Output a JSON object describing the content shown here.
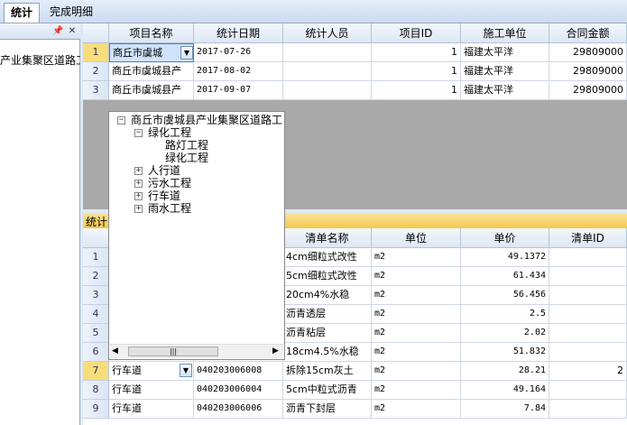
{
  "tabs": [
    {
      "label": "统计"
    },
    {
      "label": "完成明细"
    }
  ],
  "left_panel": {
    "pin_icon": "pin-icon",
    "close_icon": "close-icon",
    "text": "产业集聚区道路工"
  },
  "grid_top": {
    "headers": [
      "项目名称",
      "统计日期",
      "统计人员",
      "项目ID",
      "施工单位",
      "合同金额"
    ],
    "rows": [
      {
        "num": "1",
        "name": "商丘市虞城",
        "date": "2017-07-26",
        "staff": "",
        "id": "1",
        "unit": "福建太平洋",
        "amount": "29809000"
      },
      {
        "num": "2",
        "name": "商丘市虞城县产",
        "date": "2017-08-02",
        "staff": "",
        "id": "1",
        "unit": "福建太平洋",
        "amount": "29809000"
      },
      {
        "num": "3",
        "name": "商丘市虞城县产",
        "date": "2017-09-07",
        "staff": "",
        "id": "1",
        "unit": "福建太平洋",
        "amount": "29809000"
      }
    ]
  },
  "tree": {
    "root": "商丘市虞城县产业集聚区道路工",
    "children": [
      {
        "label": "绿化工程",
        "expanded": true,
        "items": [
          "路灯工程",
          "绿化工程"
        ]
      },
      {
        "label": "人行道",
        "expanded": false
      },
      {
        "label": "污水工程",
        "expanded": false
      },
      {
        "label": "行车道",
        "expanded": false
      },
      {
        "label": "雨水工程",
        "expanded": false
      }
    ],
    "scroll_grip": "|||"
  },
  "section_label": "统计",
  "grid_bottom": {
    "headers": [
      "清单名称",
      "单位",
      "单价",
      "清单ID"
    ],
    "rows": [
      {
        "num": "1",
        "cat": "",
        "code": "",
        "name": "4cm细粒式改性",
        "unit": "m2",
        "price": "49.1372",
        "id": ""
      },
      {
        "num": "2",
        "cat": "",
        "code": "",
        "name": "5cm细粒式改性",
        "unit": "m2",
        "price": "61.434",
        "id": ""
      },
      {
        "num": "3",
        "cat": "",
        "code": "",
        "name": "20cm4%水稳",
        "unit": "m2",
        "price": "56.456",
        "id": ""
      },
      {
        "num": "4",
        "cat": "",
        "code": "",
        "name": "沥青透层",
        "unit": "m2",
        "price": "2.5",
        "id": ""
      },
      {
        "num": "5",
        "cat": "",
        "code": "",
        "name": "沥青粘层",
        "unit": "m2",
        "price": "2.02",
        "id": ""
      },
      {
        "num": "6",
        "cat": "",
        "code": "",
        "name": "18cm4.5%水稳",
        "unit": "m2",
        "price": "51.832",
        "id": ""
      },
      {
        "num": "7",
        "cat": "行车道",
        "code": "040203006008",
        "name": "拆除15cm灰土",
        "unit": "m2",
        "price": "28.21",
        "id": "2"
      },
      {
        "num": "8",
        "cat": "行车道",
        "code": "040203006004",
        "name": "5cm中粒式沥青",
        "unit": "m2",
        "price": "49.164",
        "id": ""
      },
      {
        "num": "9",
        "cat": "行车道",
        "code": "040203006006",
        "name": "沥青下封层",
        "unit": "m2",
        "price": "7.84",
        "id": ""
      }
    ]
  },
  "colors": {
    "selected_row": "#f7dd7b",
    "active_cell": "#cfe3fb",
    "section_bar": "#f5d36a"
  }
}
